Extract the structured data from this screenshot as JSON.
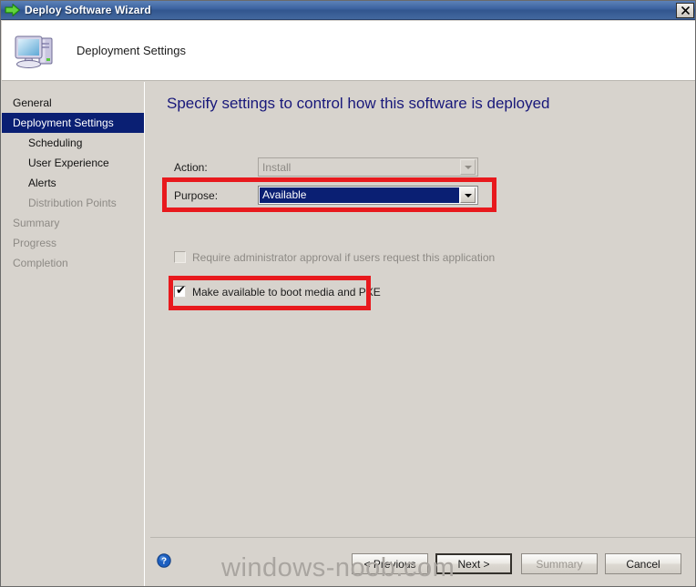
{
  "window": {
    "title": "Deploy Software Wizard",
    "title_icon": "green-arrow-icon",
    "close_label": "✕"
  },
  "header": {
    "title": "Deployment Settings",
    "icon": "computer-icon"
  },
  "sidebar": {
    "items": [
      {
        "label": "General",
        "level": 0,
        "state": "normal"
      },
      {
        "label": "Deployment Settings",
        "level": 0,
        "state": "selected"
      },
      {
        "label": "Scheduling",
        "level": 1,
        "state": "normal"
      },
      {
        "label": "User Experience",
        "level": 1,
        "state": "normal"
      },
      {
        "label": "Alerts",
        "level": 1,
        "state": "normal"
      },
      {
        "label": "Distribution Points",
        "level": 1,
        "state": "dim"
      },
      {
        "label": "Summary",
        "level": 0,
        "state": "dim"
      },
      {
        "label": "Progress",
        "level": 0,
        "state": "dim"
      },
      {
        "label": "Completion",
        "level": 0,
        "state": "dim"
      }
    ]
  },
  "content": {
    "heading": "Specify settings to control how this software is deployed",
    "action": {
      "label": "Action:",
      "value": "Install",
      "enabled": false
    },
    "purpose": {
      "label": "Purpose:",
      "value": "Available",
      "enabled": true,
      "highlighted": true
    },
    "approval_checkbox": {
      "label": "Require administrator approval if users request this application",
      "checked": false,
      "enabled": false
    },
    "pxe_checkbox": {
      "label": "Make available to boot media and PXE",
      "checked": true,
      "enabled": true,
      "tick": "✔"
    }
  },
  "annotations": {
    "color": "#e8191d",
    "boxes": [
      "purpose-row",
      "pxe-checkbox-row"
    ]
  },
  "buttonbar": {
    "help_icon": "help-question-icon",
    "previous": "< Previous",
    "next": "Next >",
    "summary": "Summary",
    "cancel": "Cancel"
  },
  "watermark": {
    "text": "windows-noob.com"
  }
}
